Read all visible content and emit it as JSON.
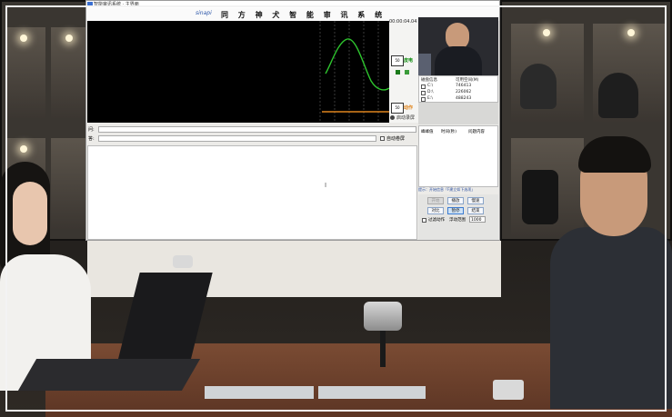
{
  "window": {
    "title": "智能审讯系统 · 主界面"
  },
  "header": {
    "logo_text": "sinapi",
    "system_title": "同 方 神 犬 智 能 审 讯 系 统"
  },
  "chart_panel": {
    "timer": "00:00:04.04",
    "upper_value": "50",
    "lower_value": "50",
    "upper_label": "皮电",
    "lower_label": "动作",
    "bottom_toggle_label": "启动录屏"
  },
  "disk_info": {
    "header_col1": "磁盘信息",
    "header_col2": "可用空间(M)",
    "rows": [
      {
        "drive": "C:\\",
        "space": "746413"
      },
      {
        "drive": "D:\\",
        "space": "226062"
      },
      {
        "drive": "E:\\",
        "space": "488243"
      }
    ]
  },
  "qa": {
    "question_label": "问:",
    "answer_label": "答:",
    "auto_scroll_label": "自动卷屏"
  },
  "peak_table": {
    "col1": "峰峰值",
    "col2": "时间(秒)",
    "col3": "问题内容"
  },
  "hint_text": "提示：开始信息「F建立如下选项」",
  "buttons": {
    "start": "开始",
    "play": "播放",
    "slow": "慢速",
    "compare": "对比",
    "pause": "暂停",
    "end": "结束",
    "filter_label": "过滤动作",
    "float_range_label": "浮动范围",
    "float_range_value": "1000"
  },
  "colors": {
    "chart_bg": "#000000",
    "green_line": "#2ec52e",
    "orange_line": "#e0851d",
    "accent": "#3b7bd1"
  }
}
